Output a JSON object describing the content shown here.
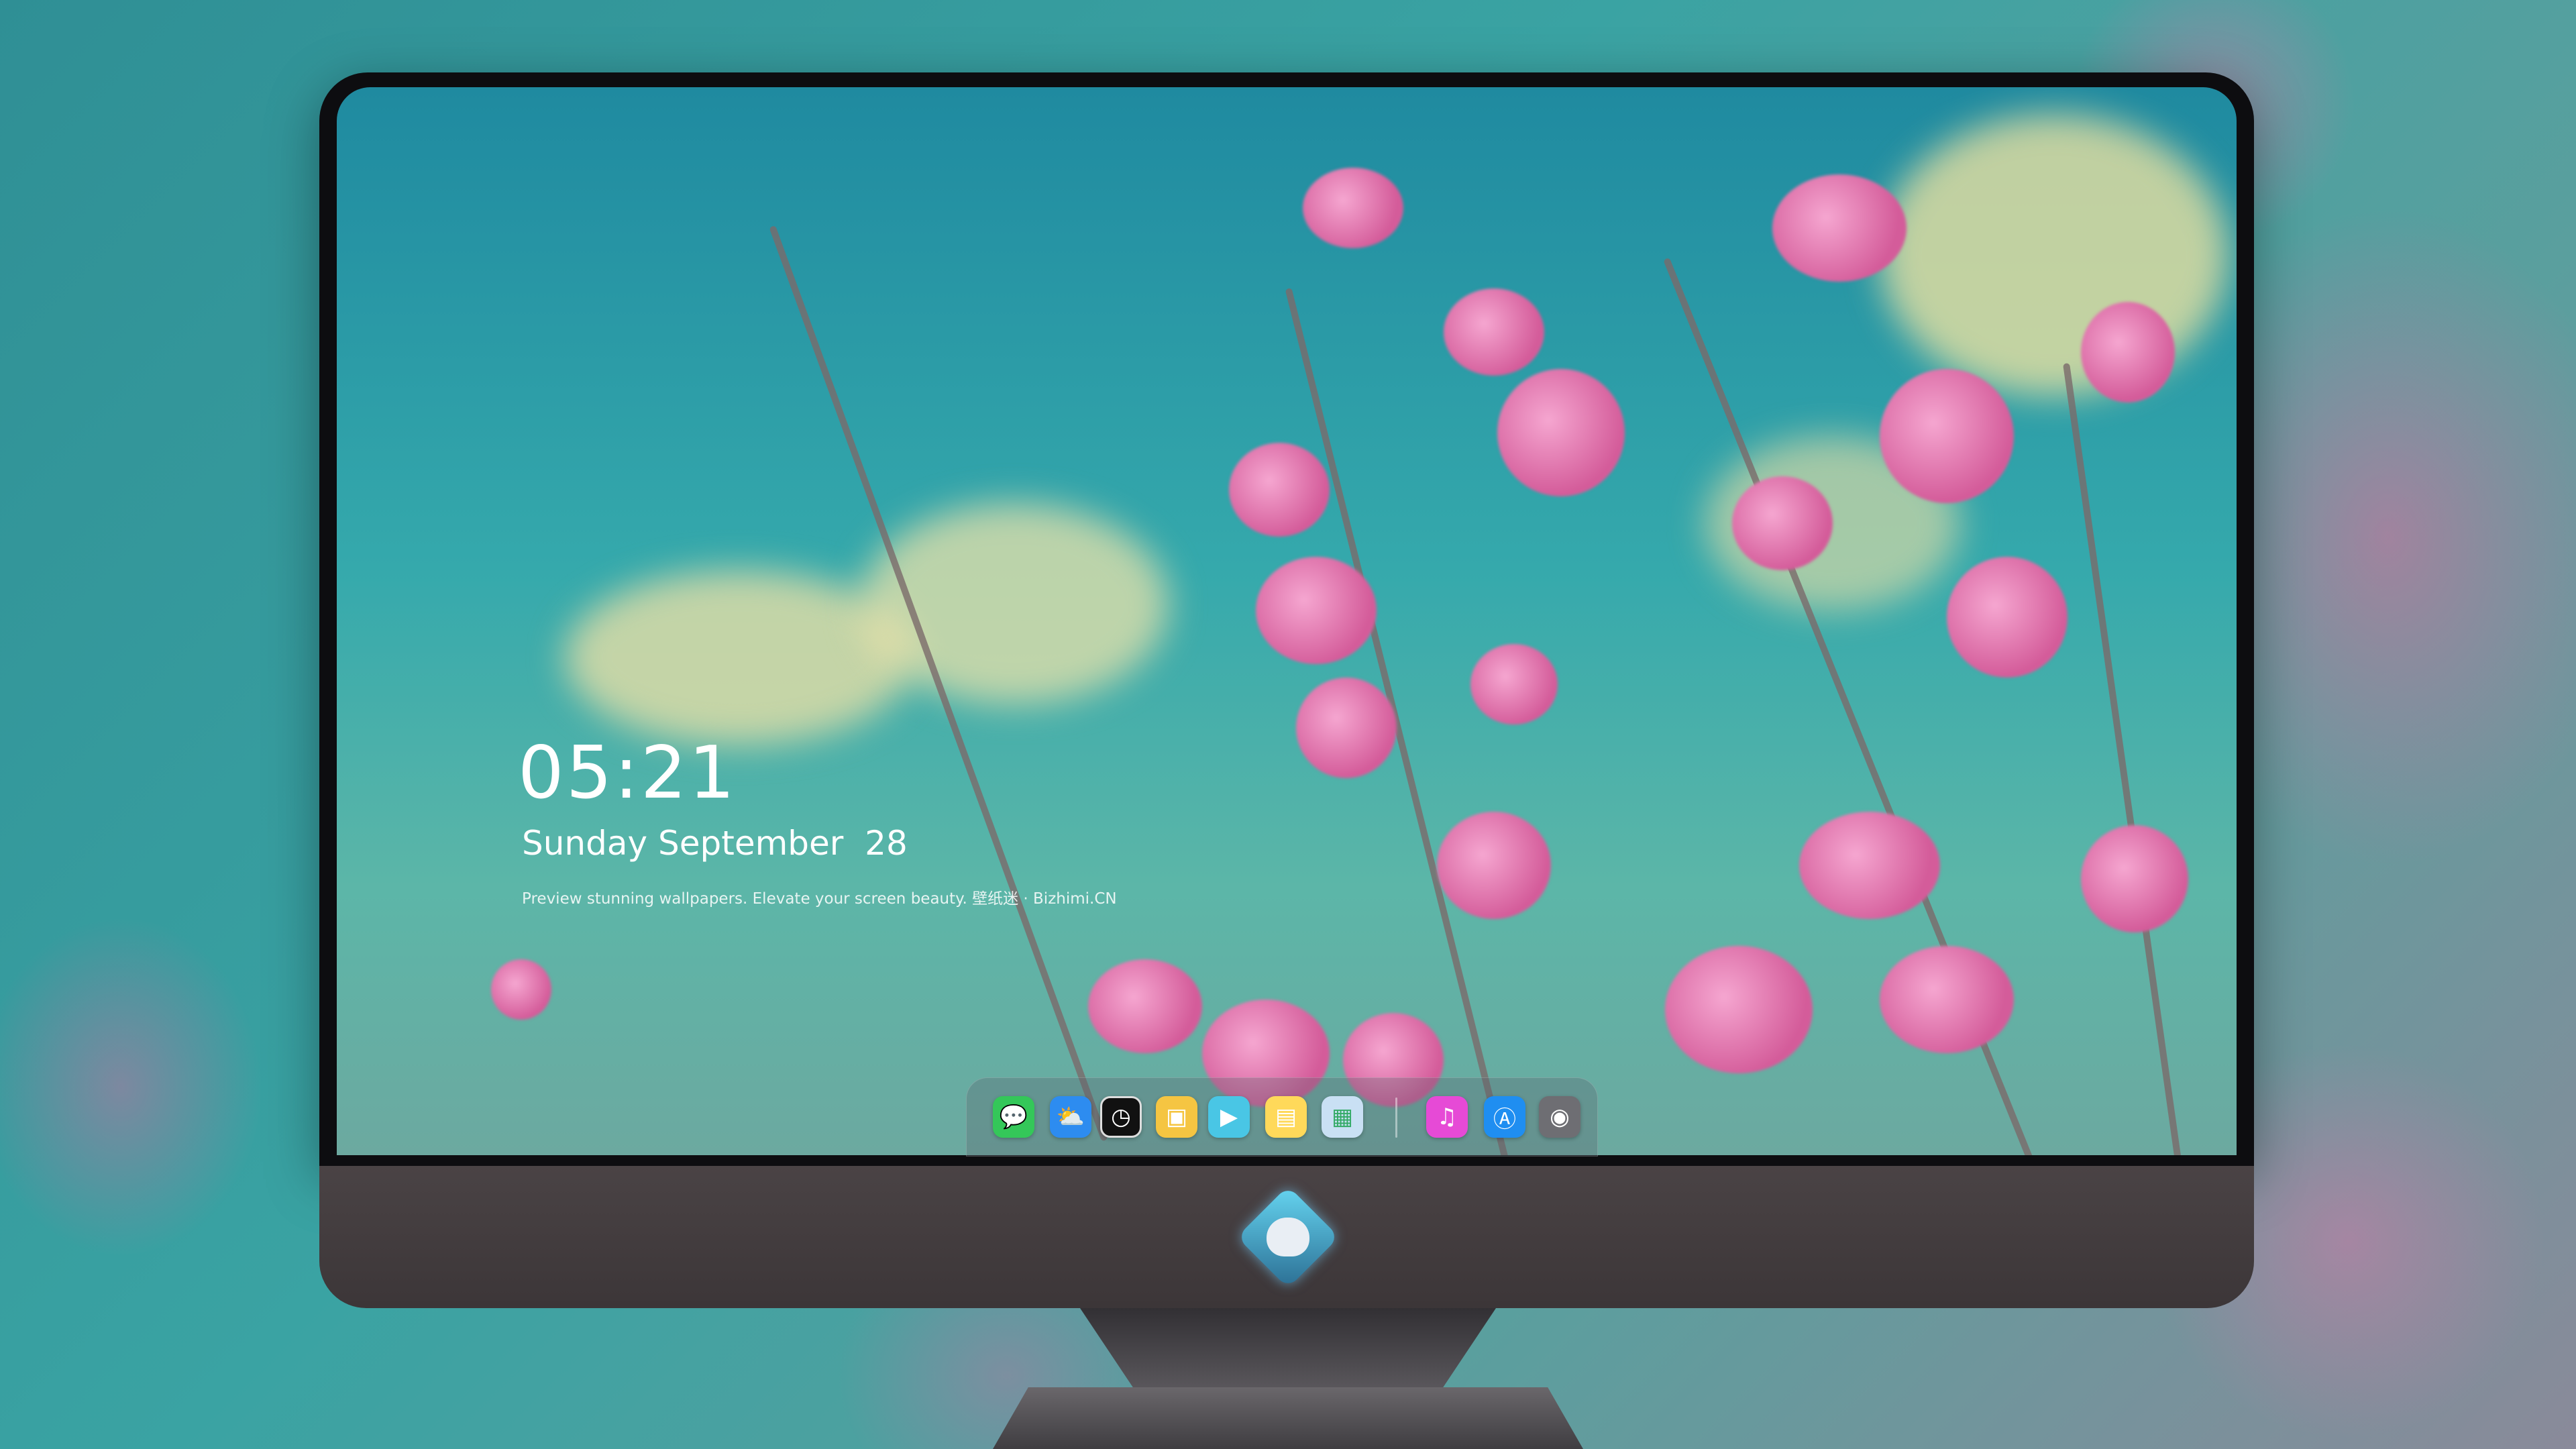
{
  "lockscreen": {
    "time": "05:21",
    "date": "Sunday September  28",
    "tagline": "Preview stunning wallpapers. Elevate your screen beauty. 壁纸迷 · Bizhimi.CN"
  },
  "dock": {
    "icons": [
      {
        "name": "messages-icon",
        "color": "#34c759",
        "glyph": "💬"
      },
      {
        "name": "weather-icon",
        "color": "#2d8cf0",
        "glyph": "⛅"
      },
      {
        "name": "clock-icon",
        "color": "#111111",
        "glyph": "🕑"
      },
      {
        "name": "preview-icon",
        "color": "#f5c542",
        "glyph": "🖼"
      },
      {
        "name": "clips-icon",
        "color": "#49c6e5",
        "glyph": "🎬"
      },
      {
        "name": "notes-icon",
        "color": "#ffd95a",
        "glyph": "▤"
      },
      {
        "name": "photo-booth-icon",
        "color": "#c9e0f4",
        "glyph": "▦"
      },
      {
        "name": "music-icon",
        "color": "#e64ad6",
        "glyph": "♫"
      },
      {
        "name": "app-store-icon",
        "color": "#1f8ef1",
        "glyph": "A"
      },
      {
        "name": "camera-icon",
        "color": "#6e6e73",
        "glyph": "📷"
      }
    ]
  }
}
